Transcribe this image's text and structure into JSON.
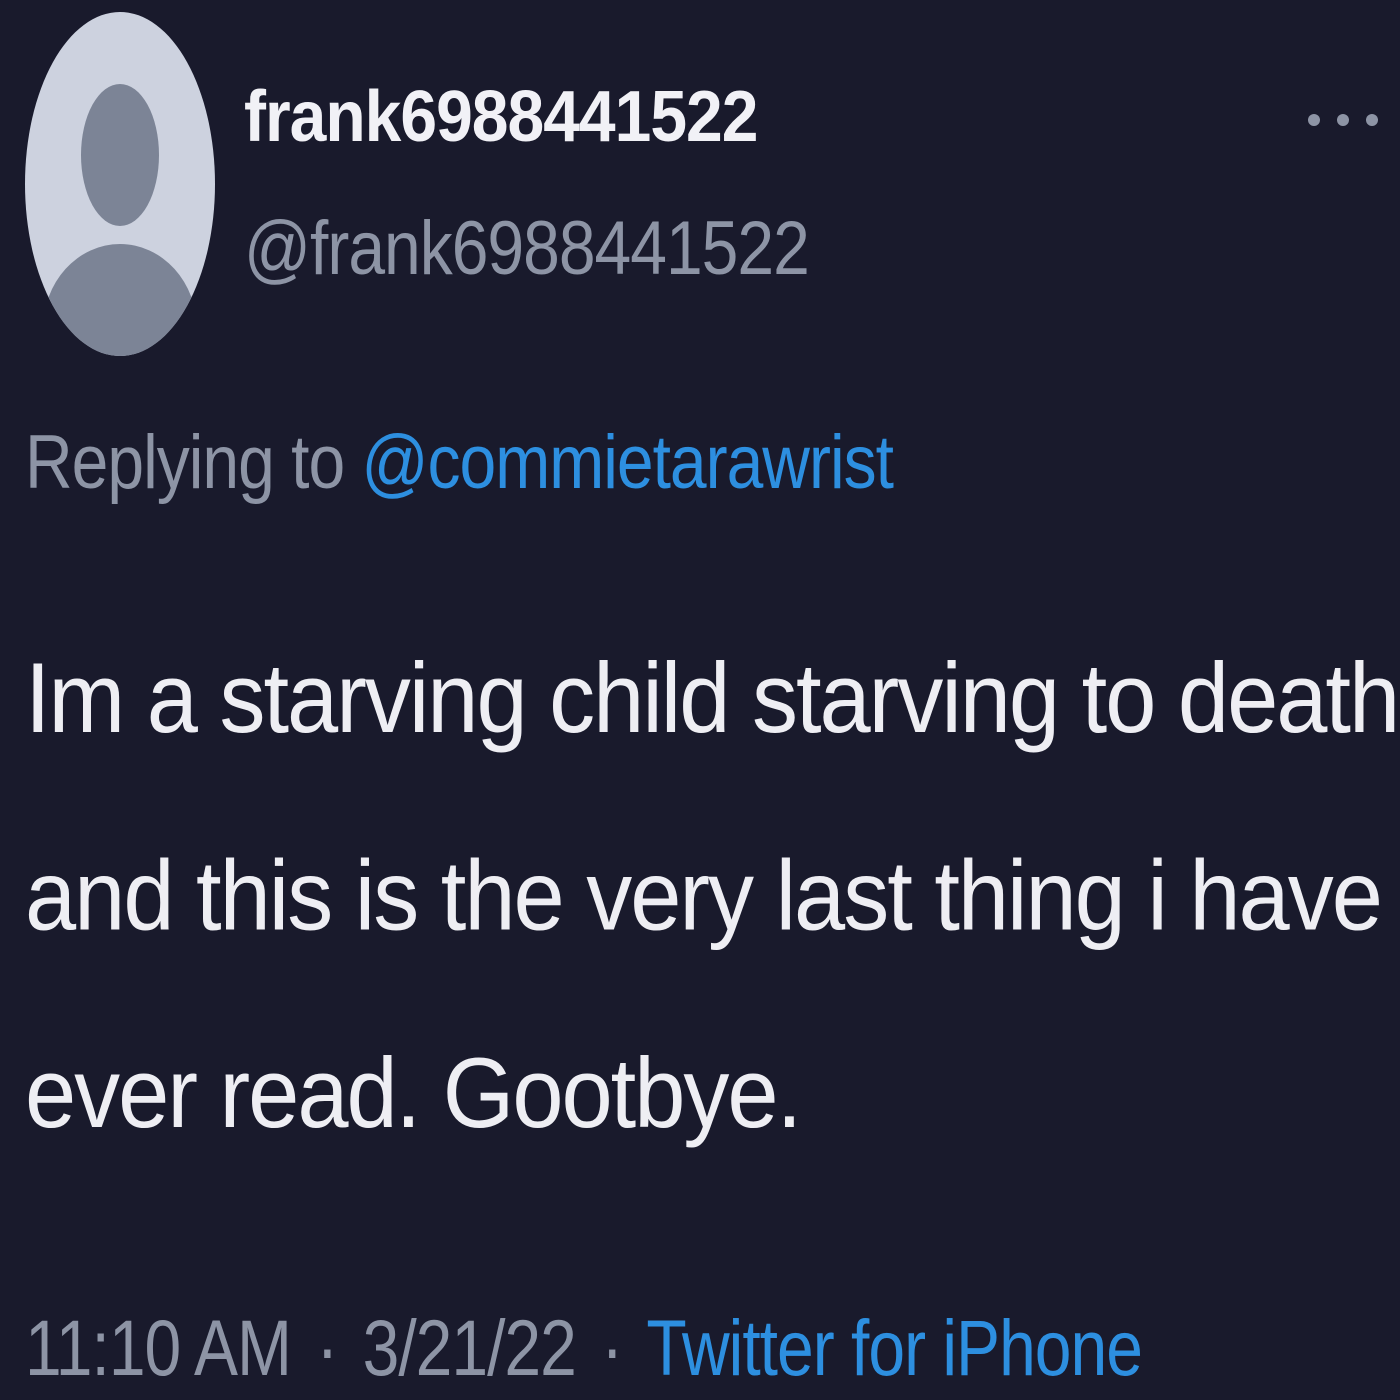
{
  "tweet": {
    "display_name": "frank6988441522",
    "handle": "@frank6988441522",
    "replying_prefix": "Replying to",
    "replying_to": "@commietarawrist",
    "body_lines": [
      "Im a starving child starving to death",
      "and this is the very last thing i have",
      "ever read. Gootbye."
    ],
    "time": "11:10 AM",
    "date": "3/21/22",
    "separator": "·",
    "source": "Twitter for iPhone"
  },
  "icons": {
    "avatar": "default-avatar-icon",
    "more": "more-options-icon"
  },
  "colors": {
    "background": "#191a2c",
    "text": "#eeeef3",
    "secondary_text": "#8d94a5",
    "link": "#2d8fe0"
  }
}
